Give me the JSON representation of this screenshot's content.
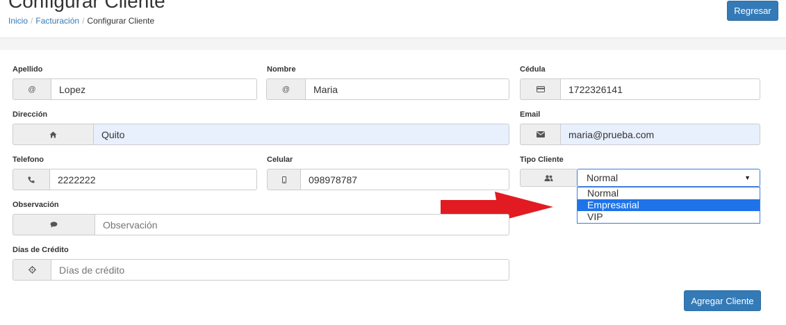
{
  "header": {
    "title": "Configurar Cliente",
    "breadcrumb": [
      "Inicio",
      "Facturación",
      "Configurar Cliente"
    ],
    "back_button": "Regresar"
  },
  "form": {
    "apellido": {
      "label": "Apellido",
      "icon": "at-icon",
      "value": "Lopez"
    },
    "nombre": {
      "label": "Nombre",
      "icon": "at-icon",
      "value": "Maria"
    },
    "cedula": {
      "label": "Cédula",
      "icon": "id-card-icon",
      "value": "1722326141"
    },
    "direccion": {
      "label": "Dirección",
      "icon": "home-icon",
      "value": "Quito"
    },
    "email": {
      "label": "Email",
      "icon": "envelope-icon",
      "value": "maria@prueba.com"
    },
    "telefono": {
      "label": "Telefono",
      "icon": "phone-icon",
      "value": "2222222"
    },
    "celular": {
      "label": "Celular",
      "icon": "mobile-icon",
      "value": "098978787"
    },
    "tipo_cliente": {
      "label": "Tipo Cliente",
      "icon": "users-icon",
      "selected": "Normal",
      "options": [
        "Normal",
        "Empresarial",
        "VIP"
      ],
      "highlighted": "Empresarial"
    },
    "observacion": {
      "label": "Observación",
      "icon": "comment-icon",
      "placeholder": "Observación"
    },
    "dias_credito": {
      "label": "Días de Crédito",
      "icon": "gear-icon",
      "placeholder": "Días de crédito"
    },
    "submit_button": "Agregar Cliente"
  },
  "colors": {
    "primary": "#337ab7",
    "autofill_bg": "#e8f0fe",
    "dropdown_highlight": "#1e73e8",
    "arrow": "#e21b23"
  }
}
